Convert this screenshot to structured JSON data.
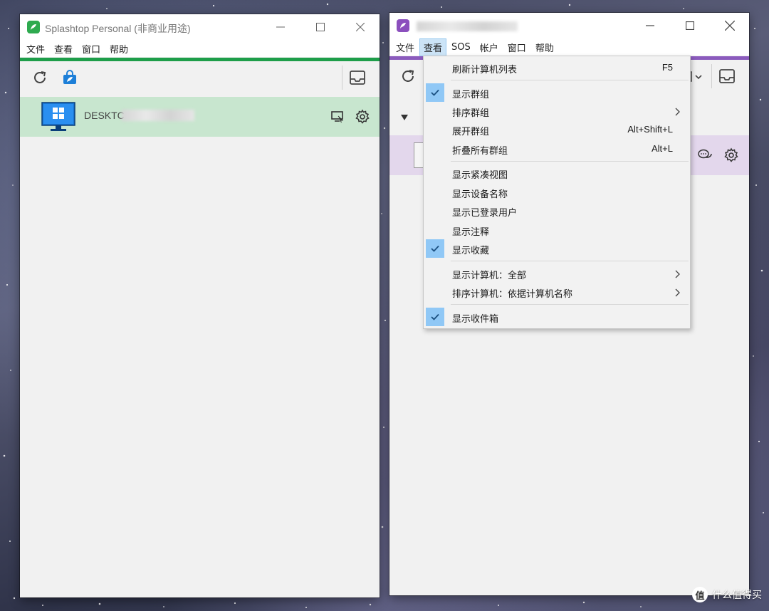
{
  "left_window": {
    "title": "Splashtop Personal (非商业用途)",
    "menu": [
      "文件",
      "查看",
      "窗口",
      "帮助"
    ],
    "accent_color": "#1e9e4a",
    "computer": {
      "name": "DESKTC",
      "selected_bg": "#c8e6cf"
    },
    "icons": {
      "refresh": "refresh-icon",
      "store": "store-bag-icon",
      "inbox": "inbox-icon",
      "device": "windows-monitor-icon",
      "remote": "remote-desktop-icon",
      "settings": "gear-icon"
    }
  },
  "right_window": {
    "menu": [
      "文件",
      "查看",
      "SOS",
      "帐户",
      "窗口",
      "帮助"
    ],
    "active_menu_index": 1,
    "accent_color": "#8b5bbd",
    "selected_row_bg": "#e3d7ec"
  },
  "view_menu": {
    "items": [
      {
        "label": "刷新计算机列表",
        "shortcut": "F5",
        "checked": false,
        "submenu": false
      },
      {
        "label": "显示群组",
        "shortcut": "",
        "checked": true,
        "submenu": false
      },
      {
        "label": "排序群组",
        "shortcut": "",
        "checked": false,
        "submenu": true
      },
      {
        "label": "展开群组",
        "shortcut": "Alt+Shift+L",
        "checked": false,
        "submenu": false
      },
      {
        "label": "折叠所有群组",
        "shortcut": "Alt+L",
        "checked": false,
        "submenu": false
      },
      {
        "label": "显示紧凑视图",
        "shortcut": "",
        "checked": false,
        "submenu": false
      },
      {
        "label": "显示设备名称",
        "shortcut": "",
        "checked": false,
        "submenu": false
      },
      {
        "label": "显示已登录用户",
        "shortcut": "",
        "checked": false,
        "submenu": false
      },
      {
        "label": "显示注释",
        "shortcut": "",
        "checked": false,
        "submenu": false
      },
      {
        "label": "显示收藏",
        "shortcut": "",
        "checked": true,
        "submenu": false
      },
      {
        "label": "显示计算机：全部",
        "shortcut": "",
        "checked": false,
        "submenu": true
      },
      {
        "label": "排序计算机：依据计算机名称",
        "shortcut": "",
        "checked": false,
        "submenu": true
      },
      {
        "label": "显示收件箱",
        "shortcut": "",
        "checked": true,
        "submenu": false
      }
    ]
  },
  "watermark": {
    "text": "什么值得买",
    "logo": "值"
  }
}
